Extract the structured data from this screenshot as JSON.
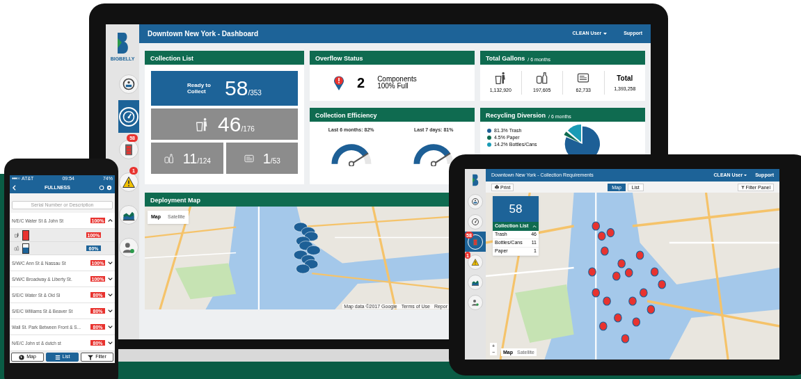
{
  "laptop": {
    "logo": "BIGBELLY",
    "header": {
      "title": "Downtown New York - Dashboard",
      "user": "CLEAN User",
      "link": "Support"
    },
    "sidebar": [
      {
        "kind": "dashboard",
        "selected": false
      },
      {
        "kind": "gauge",
        "selected": true
      },
      {
        "kind": "battery",
        "selected": false,
        "badge": "58"
      },
      {
        "kind": "warning",
        "selected": false,
        "badge": "1"
      },
      {
        "kind": "chart",
        "selected": false
      },
      {
        "kind": "user",
        "selected": false
      }
    ],
    "collection_list": {
      "title": "Collection List",
      "tiles": [
        {
          "kind": "ready",
          "label": "Ready to Collect",
          "value": "58",
          "total": "/353"
        },
        {
          "kind": "trash",
          "value": "46",
          "total": "/176"
        },
        {
          "kind": "bottles",
          "value": "11",
          "total": "/124"
        },
        {
          "kind": "paper",
          "value": "1",
          "total": "/53"
        }
      ]
    },
    "overflow": {
      "title": "Overflow Status",
      "count": "2",
      "line1": "Components",
      "line2": "100% Full"
    },
    "total_gallons": {
      "title": "Total Gallons",
      "subtitle": "/ 6 months",
      "items": [
        {
          "kind": "trash",
          "value": "1,132,920"
        },
        {
          "kind": "bottles",
          "value": "197,605"
        },
        {
          "kind": "paper",
          "value": "62,733"
        },
        {
          "kind": "total",
          "label": "Total",
          "value": "1,393,258"
        }
      ]
    },
    "efficiency": {
      "title": "Collection Efficiency",
      "gauges": [
        {
          "label": "Last 6 months: 82%"
        },
        {
          "label": "Last 7 days: 81%"
        }
      ]
    },
    "recycling": {
      "title": "Recycling Diversion",
      "subtitle": "/ 6 months",
      "legend": [
        {
          "label": "81.3% Trash",
          "color": "#1d5f96"
        },
        {
          "label": "4.5% Paper",
          "color": "#0f6b50"
        },
        {
          "label": "14.2% Bottles/Cans",
          "color": "#1a9bb5"
        }
      ]
    },
    "map": {
      "title": "Deployment Map",
      "modes": [
        {
          "label": "Map",
          "selected": true
        },
        {
          "label": "Satellite",
          "selected": false
        }
      ],
      "attribution": "Map data ©2017 Google",
      "terms": "Terms of Use",
      "report": "Repor"
    }
  },
  "tablet": {
    "header": {
      "title": "Downtown New York - Collection Requirements",
      "user": "CLEAN User",
      "link": "Support"
    },
    "sidebar": [
      {
        "kind": "dashboard",
        "selected": false
      },
      {
        "kind": "gauge",
        "selected": false
      },
      {
        "kind": "battery",
        "selected": true,
        "badge": "58"
      },
      {
        "kind": "warning",
        "selected": false,
        "badge": "1"
      },
      {
        "kind": "chart",
        "selected": false
      },
      {
        "kind": "user",
        "selected": false
      }
    ],
    "print": "Print",
    "views": [
      {
        "label": "Map",
        "selected": true
      },
      {
        "label": "List",
        "selected": false
      }
    ],
    "filter": "Filter Panel",
    "summary": {
      "count": "58",
      "title": "Collection List",
      "expanded": true,
      "rows": [
        {
          "label": "Trash",
          "value": "46"
        },
        {
          "label": "Bottles/Cans",
          "value": "11"
        },
        {
          "label": "Paper",
          "value": "1"
        }
      ]
    },
    "zoom": [
      "+",
      "−"
    ],
    "modes": [
      {
        "label": "Map",
        "selected": true
      },
      {
        "label": "Satellite",
        "selected": false
      }
    ]
  },
  "phone": {
    "status": {
      "carrier": "AT&T",
      "time": "09:54",
      "battery": "74%"
    },
    "title": "FULLNESS",
    "search": {
      "placeholder": "Serial Number or Description"
    },
    "rows": [
      {
        "label": "N/E/C Water St & John St",
        "percent": "100%",
        "color": "#e8332f",
        "expanded": true,
        "children": [
          {
            "kind": "trash",
            "level": 1,
            "percent": "100%",
            "color": "#e8332f"
          },
          {
            "kind": "bottles",
            "level": 0.6,
            "percent": "60%",
            "color": "#1d6398"
          }
        ]
      },
      {
        "label": "S/W/C Ann St & Nassau St",
        "percent": "100%",
        "color": "#e8332f",
        "expanded": false
      },
      {
        "label": "S/W/C Broadway & Liberty St.",
        "percent": "100%",
        "color": "#e8332f",
        "expanded": false
      },
      {
        "label": "S/E/C Water St & Old Sl",
        "percent": "80%",
        "color": "#e8332f",
        "expanded": false
      },
      {
        "label": "S/E/C Williams St & Beaver St",
        "percent": "80%",
        "color": "#e8332f",
        "expanded": false
      },
      {
        "label": "Wall St. Park Between Front & S...",
        "percent": "80%",
        "color": "#e8332f",
        "expanded": false
      },
      {
        "label": "N/E/C John st & dutch st",
        "percent": "80%",
        "color": "#e8332f",
        "expanded": false
      }
    ],
    "tabs": [
      {
        "kind": "map",
        "label": "Map",
        "selected": false
      },
      {
        "kind": "list",
        "label": "List",
        "selected": true
      },
      {
        "kind": "filter",
        "label": "Filter",
        "selected": false
      }
    ]
  }
}
